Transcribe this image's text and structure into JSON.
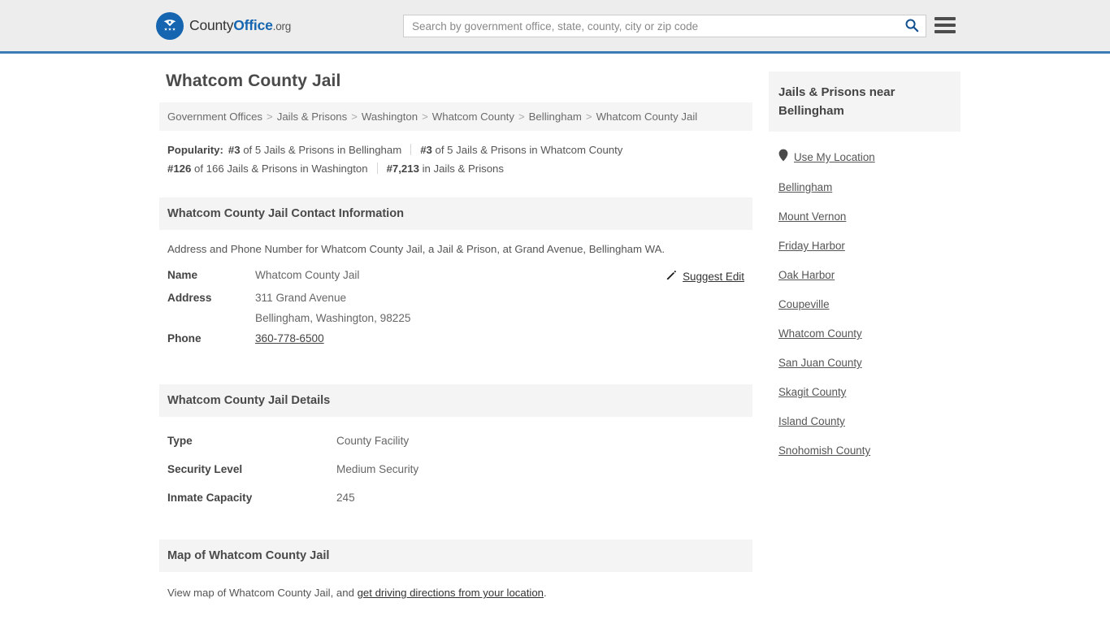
{
  "header": {
    "logo": {
      "part1": "County",
      "part2": "Office",
      "part3": ".org",
      "icon": "eagle-seal-icon"
    },
    "search": {
      "placeholder": "Search by government office, state, county, city or zip code",
      "value": ""
    },
    "search_icon": "search-icon",
    "menu_icon": "hamburger-menu-icon",
    "accent_color": "#3c7cb5"
  },
  "page": {
    "title": "Whatcom County Jail"
  },
  "breadcrumb": {
    "separator": ">",
    "items": [
      "Government Offices",
      "Jails & Prisons",
      "Washington",
      "Whatcom County",
      "Bellingham",
      "Whatcom County Jail"
    ]
  },
  "popularity": {
    "label": "Popularity:",
    "items": [
      {
        "rank": "#3",
        "text": "of 5 Jails & Prisons in Bellingham"
      },
      {
        "rank": "#3",
        "text": "of 5 Jails & Prisons in Whatcom County"
      },
      {
        "rank": "#126",
        "text": "of 166 Jails & Prisons in Washington"
      },
      {
        "rank": "#7,213",
        "text": "in Jails & Prisons"
      }
    ]
  },
  "contact": {
    "heading": "Whatcom County Jail Contact Information",
    "description": "Address and Phone Number for Whatcom County Jail, a Jail & Prison, at Grand Avenue, Bellingham WA.",
    "suggest_edit": "Suggest Edit",
    "suggest_edit_icon": "edit-pencil-icon",
    "rows": [
      {
        "key": "Name",
        "value": "Whatcom County Jail"
      },
      {
        "key": "Address",
        "value": "311 Grand Avenue"
      },
      {
        "key": "",
        "value": "Bellingham, Washington, 98225"
      },
      {
        "key": "Phone",
        "value": "360-778-6500"
      }
    ]
  },
  "details": {
    "heading": "Whatcom County Jail Details",
    "rows": [
      {
        "key": "Type",
        "value": "County Facility"
      },
      {
        "key": "Security Level",
        "value": "Medium Security"
      },
      {
        "key": "Inmate Capacity",
        "value": "245"
      }
    ]
  },
  "map": {
    "heading": "Map of Whatcom County Jail",
    "note_before": "View map of Whatcom County Jail, and ",
    "note_link": "get driving directions from your location",
    "note_after": "."
  },
  "sidebar": {
    "heading": "Jails & Prisons near Bellingham",
    "location_icon": "map-pin-icon",
    "items": [
      "Use My Location",
      "Bellingham",
      "Mount Vernon",
      "Friday Harbor",
      "Oak Harbor",
      "Coupeville",
      "Whatcom County",
      "San Juan County",
      "Skagit County",
      "Island County",
      "Snohomish County"
    ]
  }
}
